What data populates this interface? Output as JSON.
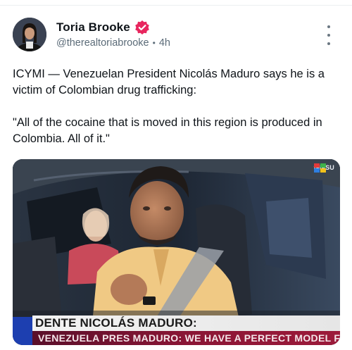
{
  "post": {
    "author_name": "Toria Brooke",
    "handle": "@therealtoriabrooke",
    "separator": "•",
    "time": "4h",
    "text_paragraphs": [
      "ICYMI — Venezuelan President Nicolás Maduro says he is a victim of Colombian drug trafficking:",
      "\"All of the cocaine that is moved in this region is produced in Colombia. All of it.\""
    ]
  },
  "media": {
    "chyron_main": "DENTE NICOLÁS MADURO:",
    "chyron_sub": "VENEZUELA PRES MADURO: WE HAVE A PERFECT MODEL FOR",
    "network_logo": "teleSU"
  },
  "icons": {
    "verified": "verified-badge-icon",
    "more": "more-options-icon"
  },
  "colors": {
    "verified_badge": "#e8265e",
    "chyron_blue": "#1d3fb0",
    "chyron_red": "#8a1535"
  }
}
